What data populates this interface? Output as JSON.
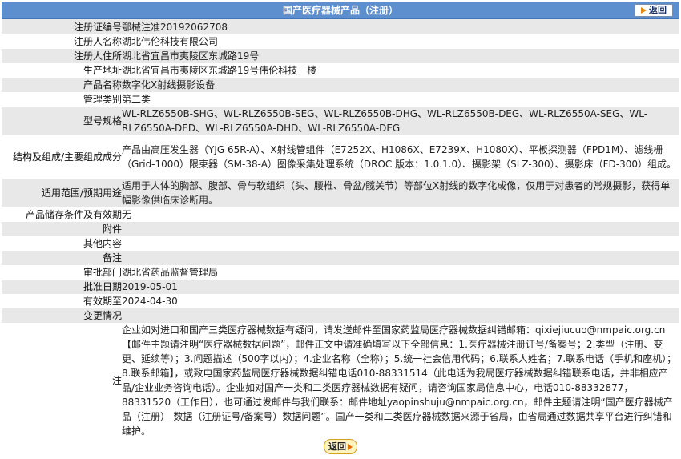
{
  "header": {
    "title": "国产医疗器械产品（注册）",
    "back_label": "返回"
  },
  "rows": [
    {
      "label": "注册证编号",
      "value": "鄂械注准20192062708"
    },
    {
      "label": "注册人名称",
      "value": "湖北伟伦科技有限公司"
    },
    {
      "label": "注册人住所",
      "value": "湖北省宜昌市夷陵区东城路19号"
    },
    {
      "label": "生产地址",
      "value": "湖北省宜昌市夷陵区东城路19号伟伦科技一楼"
    },
    {
      "label": "产品名称",
      "value": "数字化X射线摄影设备"
    },
    {
      "label": "管理类别",
      "value": "第二类"
    },
    {
      "label": "型号规格",
      "value": "WL-RLZ6550B-SHG、WL-RLZ6550B-SEG、WL-RLZ6550B-DHG、WL-RLZ6550B-DEG、WL-RLZ6550A-SEG、WL-RLZ6550A-DED、WL-RLZ6550A-DHD、WL-RLZ6550A-DEG"
    },
    {
      "label": "结构及组成/主要组成成分",
      "value": "产品由高压发生器（YJG 65R-A）、X射线管组件（E7252X、H1086X、E7239X、H1080X）、平板探测器（FPD1M）、滤线栅（Grid-1000）限束器（SM-38-A）图像采集处理系统（DROC 版本：1.0.1.0）、摄影架（SLZ-300）、摄影床（FD-300）组成。"
    },
    {
      "label": "适用范围/预期用途",
      "value": "适用于人体的胸部、腹部、骨与软组织（头、腰椎、骨盆/髋关节）等部位X射线的数字化成像，仅用于对患者的常规摄影，获得单幅影像供临床诊断用。"
    },
    {
      "label": "产品储存条件及有效期",
      "value": "无"
    },
    {
      "label": "附件",
      "value": ""
    },
    {
      "label": "其他内容",
      "value": ""
    },
    {
      "label": "备注",
      "value": ""
    },
    {
      "label": "审批部门",
      "value": "湖北省药品监督管理局"
    },
    {
      "label": "批准日期",
      "value": "2019-05-01"
    },
    {
      "label": "有效期至",
      "value": "2024-04-30"
    },
    {
      "label": "变更情况",
      "value": ""
    },
    {
      "label": "注",
      "value": "企业如对进口和国产三类医疗器械数据有疑问，请发送邮件至国家药监局医疗器械数据纠错邮箱：qixiejiucuo@nmpaic.org.cn【邮件主题请注明“医疗器械数据问题”，邮件正文中请准确填写以下全部信息：1.医疗器械注册证号/备案号；2.类型（注册、变更、延续等）；3.问题描述（500字以内）；4.企业名称（全称）；5.统一社会信用代码；6.联系人姓名；7.联系电话（手机和座机）；8.联系邮箱】，或致电国家药监局医疗器械数据纠错电话010-88331514（此电话为我局医疗器械数据纠错联系电话，并非相应产品/企业业务咨询电话）。企业如对国产一类和二类医疗器械数据有疑问，请咨询国家局信息中心，电话010-88332877，88331520（工作日），也可通过发邮件与我们联系：邮件地址yaopinshuju@nmpaic.org.cn，邮件主题请注明“国产医疗器械产品（注册）-数据（注册证号/备案号）数据问题”。国产一类和二类医疗器械数据来源于省局，由省局通过数据共享平台进行纠错和维护。"
    }
  ],
  "footer": {
    "back_label": "返回"
  }
}
